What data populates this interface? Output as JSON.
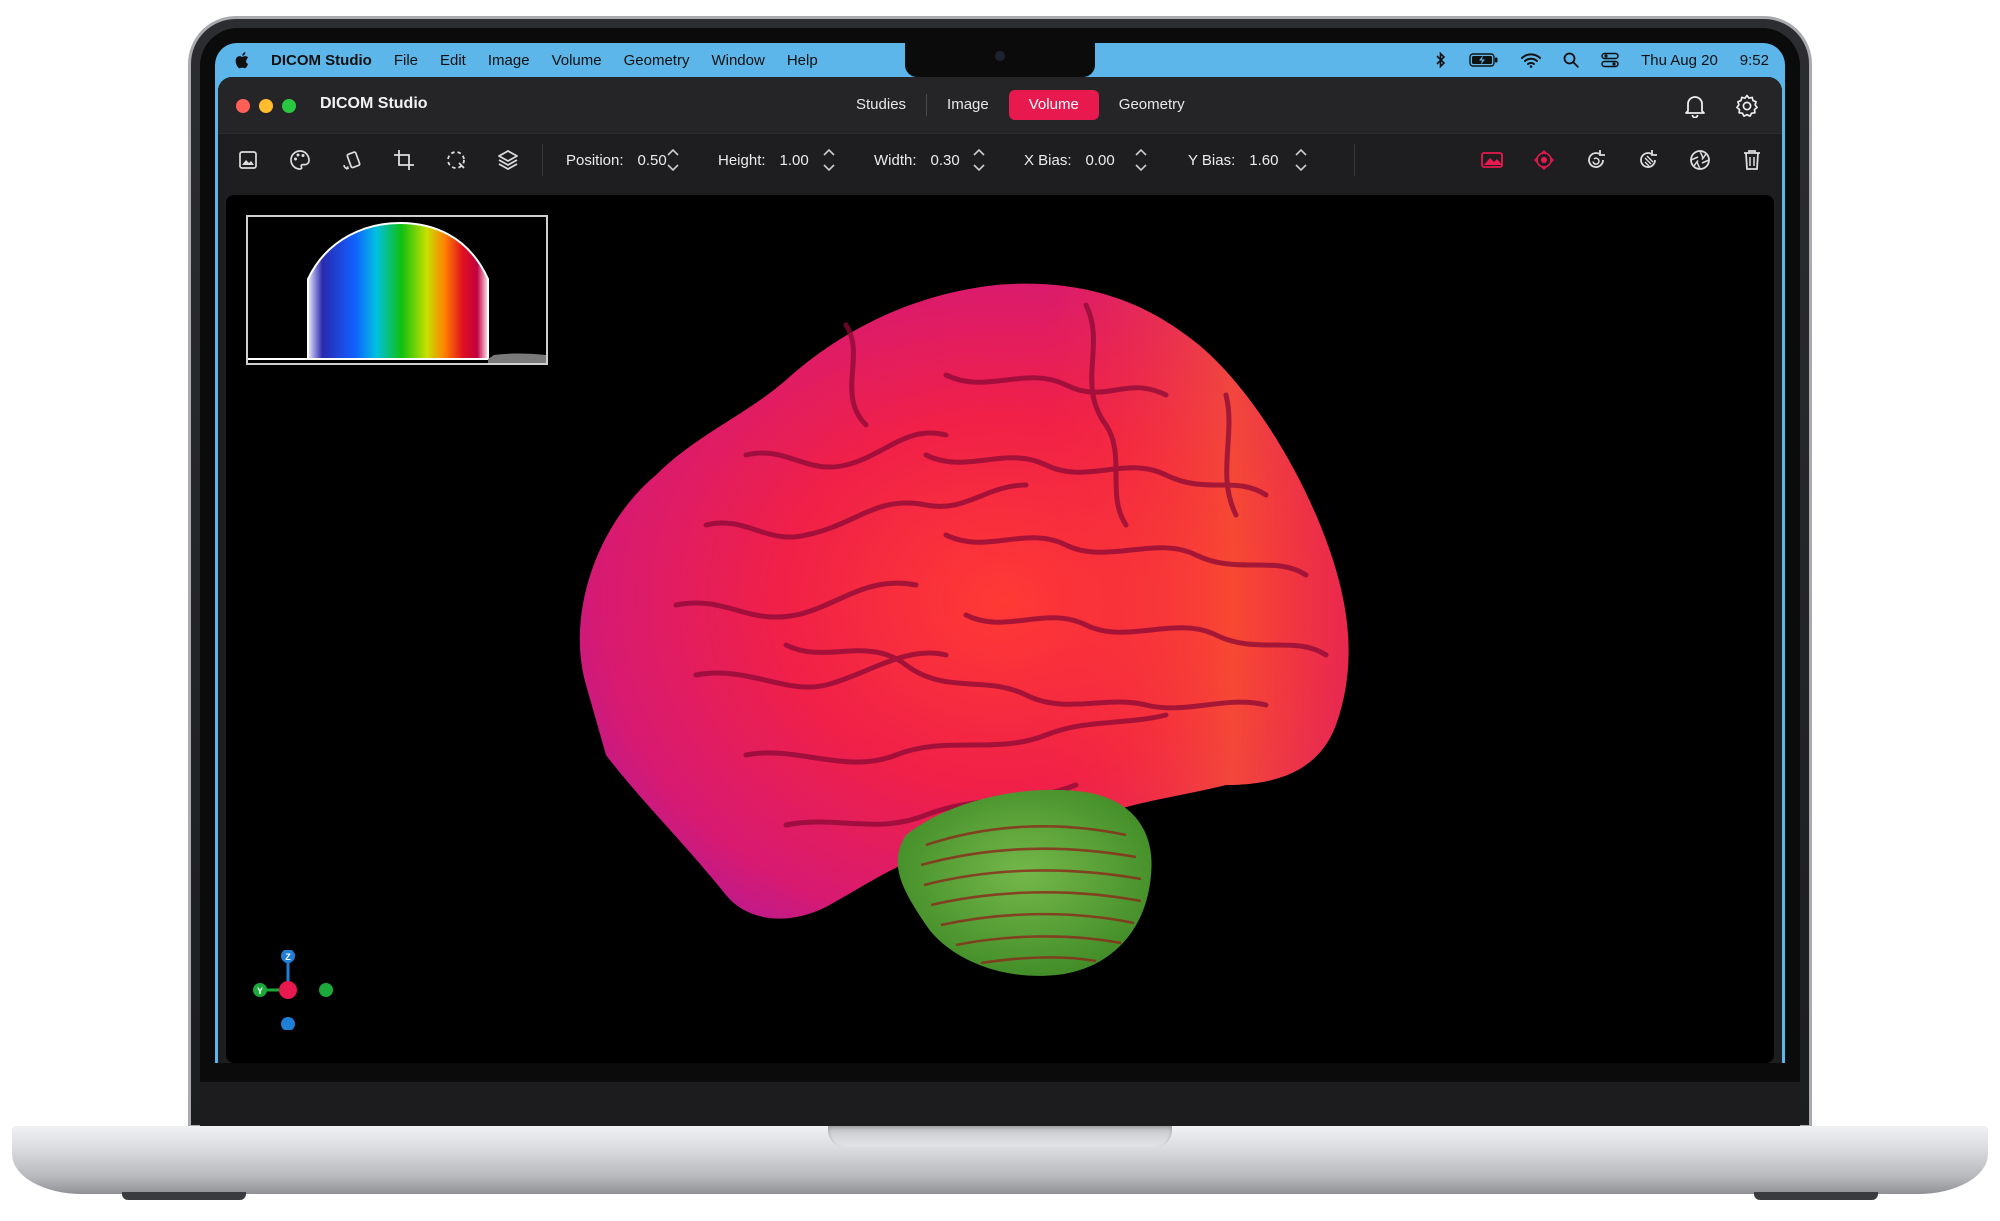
{
  "menubar": {
    "app_name": "DICOM Studio",
    "menus": [
      "File",
      "Edit",
      "Image",
      "Volume",
      "Geometry",
      "Window",
      "Help"
    ],
    "date": "Thu Aug 20",
    "time": "9:52"
  },
  "window": {
    "title": "DICOM Studio",
    "tabs": [
      {
        "label": "Studies",
        "active": false
      },
      {
        "label": "Image",
        "active": false
      },
      {
        "label": "Volume",
        "active": true
      },
      {
        "label": "Geometry",
        "active": false
      }
    ],
    "accent_color": "#e8194e"
  },
  "toolbar": {
    "tools_left": [
      "image-icon",
      "palette-icon",
      "rotate-icon",
      "crop-icon",
      "lasso-select-icon",
      "layers-icon"
    ],
    "params": [
      {
        "label": "Position:",
        "value": "0.50"
      },
      {
        "label": "Height:",
        "value": "1.00"
      },
      {
        "label": "Width:",
        "value": "0.30"
      },
      {
        "label": "X Bias:",
        "value": "0.00"
      },
      {
        "label": "Y Bias:",
        "value": "1.60"
      }
    ],
    "tools_right": [
      "landscape-icon",
      "recenter-icon",
      "reset-rotation-icon",
      "clear-rotation-icon",
      "aperture-icon",
      "trash-icon"
    ]
  },
  "viewport": {
    "orientation_labels": {
      "z": "Z",
      "y": "Y"
    },
    "colors": {
      "cerebrum": "#e8174e",
      "cerebellum": "#4e9a2e"
    }
  }
}
